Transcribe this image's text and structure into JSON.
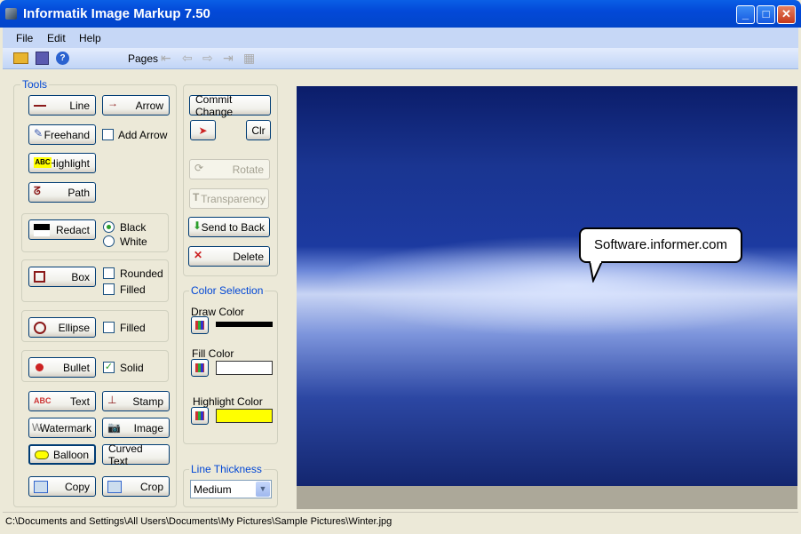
{
  "window": {
    "title": "Informatik Image Markup 7.50"
  },
  "menu": [
    "File",
    "Edit",
    "Help"
  ],
  "toolbar": {
    "pages_label": "Pages",
    "icons": [
      "open-folder-icon",
      "save-icon",
      "help-icon",
      "first-page-icon",
      "prev-page-icon",
      "next-page-icon",
      "last-page-icon",
      "thumbnails-icon"
    ]
  },
  "tools": {
    "title": "Tools",
    "line": "Line",
    "arrow": "Arrow",
    "freehand": "Freehand",
    "add_arrow": "Add Arrow",
    "add_arrow_checked": false,
    "highlight": "Highlight",
    "highlight_icon_text": "ABC",
    "path": "Path",
    "redact": "Redact",
    "black": "Black",
    "white": "White",
    "redact_color": "Black",
    "box": "Box",
    "rounded": "Rounded",
    "rounded_checked": false,
    "box_filled": "Filled",
    "box_filled_checked": false,
    "ellipse": "Ellipse",
    "ellipse_filled": "Filled",
    "ellipse_filled_checked": false,
    "bullet": "Bullet",
    "solid": "Solid",
    "solid_checked": true,
    "text": "Text",
    "text_icon": "ABC",
    "stamp": "Stamp",
    "watermark": "Watermark",
    "image": "Image",
    "balloon": "Balloon",
    "curved_text": "Curved Text",
    "copy": "Copy",
    "crop": "Crop"
  },
  "actions": {
    "commit": "Commit Change",
    "clr": "Clr",
    "rotate": "Rotate",
    "transparency": "Transparency",
    "send_to_back": "Send to Back",
    "delete": "Delete"
  },
  "colors": {
    "title": "Color Selection",
    "draw_label": "Draw Color",
    "draw": "#000000",
    "fill_label": "Fill Color",
    "fill": "#ffffff",
    "highlight_label": "Highlight Color",
    "highlight": "#ffff00"
  },
  "thickness": {
    "title": "Line Thickness",
    "value": "Medium"
  },
  "canvas": {
    "balloon_text": "Software.informer.com"
  },
  "status": {
    "path": "C:\\Documents and Settings\\All Users\\Documents\\My Pictures\\Sample Pictures\\Winter.jpg"
  }
}
